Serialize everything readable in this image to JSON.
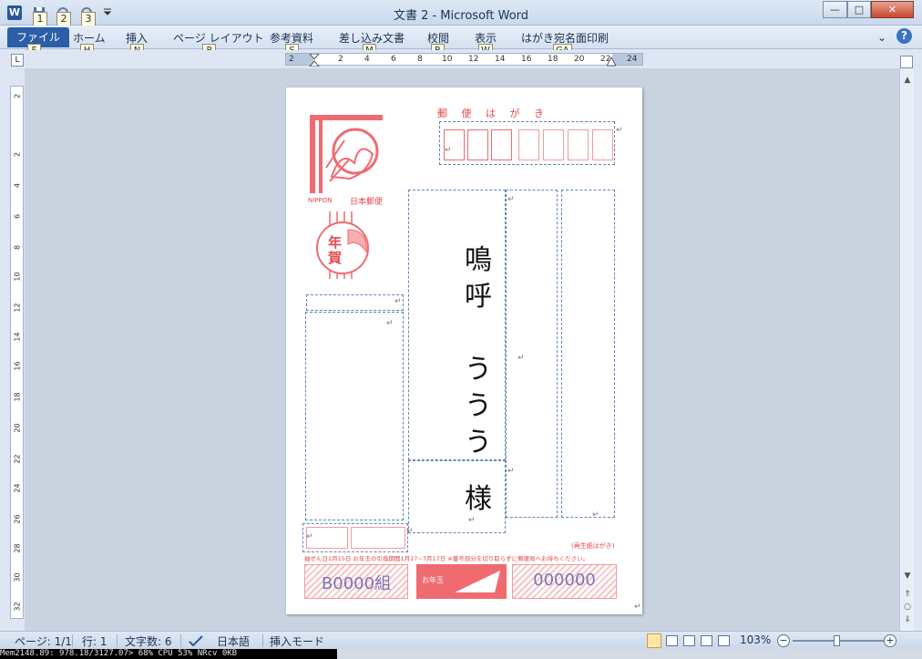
{
  "window": {
    "title": "文書 2 - Microsoft Word",
    "app_icon_letter": "W",
    "qat_keytips": [
      "1",
      "2",
      "3"
    ],
    "min_label": "—",
    "max_label": "□",
    "close_label": "✕"
  },
  "ribbon": {
    "tabs": [
      {
        "label": "ファイル",
        "keytip": "F"
      },
      {
        "label": "ホーム",
        "keytip": "H"
      },
      {
        "label": "挿入",
        "keytip": "N"
      },
      {
        "label": "ページ レイアウト",
        "keytip": "P"
      },
      {
        "label": "参考資料",
        "keytip": "S"
      },
      {
        "label": "差し込み文書",
        "keytip": "M"
      },
      {
        "label": "校閲",
        "keytip": "R"
      },
      {
        "label": "表示",
        "keytip": "W"
      },
      {
        "label": "はがき宛名面印刷",
        "keytip": "GA"
      }
    ],
    "collapse_label": "⌄",
    "help_label": "?"
  },
  "ruler": {
    "tab_selector": "L",
    "h_numbers": [
      "2",
      "2",
      "4",
      "6",
      "8",
      "10",
      "12",
      "14",
      "16",
      "18",
      "20",
      "22",
      "24"
    ],
    "v_numbers": [
      "2",
      "",
      "2",
      "4",
      "6",
      "8",
      "10",
      "12",
      "14",
      "16",
      "18",
      "20",
      "22",
      "24",
      "26",
      "28",
      "30",
      "32"
    ]
  },
  "postcard": {
    "header": "郵 便 は が き",
    "stamp_maker": "NIPPON",
    "stamp_japan": "日本郵便",
    "nenga": "年賀",
    "recipient_name_chars": [
      "鳴",
      "呼",
      "",
      "う",
      "う",
      "う"
    ],
    "honorific": "様",
    "reuse_label": "(再生紙はがき)",
    "notice": "抽せん日1月15日 お年玉の引換期間1月17~7月17日 ※番号部分を切り取らずに郵便局へお持ちください。",
    "lottery_group": "B0000組",
    "lottery_number": "000000",
    "otoshidama": "お年玉"
  },
  "status": {
    "page": "ページ: 1/1",
    "line": "行: 1",
    "chars": "文字数: 6",
    "language": "日本語",
    "mode": "挿入モード",
    "zoom": "103%"
  },
  "monitor": {
    "text": "Mem2148.89: 978.18/3127.07> 68% CPU 53% NRcv   0KB"
  }
}
